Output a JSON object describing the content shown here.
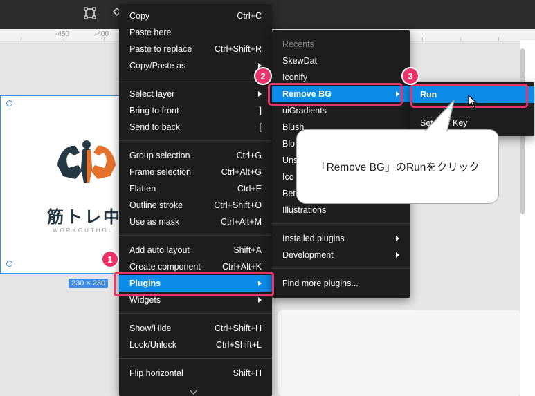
{
  "ruler": {
    "labels": [
      "-450",
      "-400"
    ]
  },
  "canvas": {
    "logo_text": "筋トレ中",
    "logo_sub": "WORKOUTHOL",
    "frame_size": "230 × 230"
  },
  "context_menu": {
    "items": [
      {
        "label": "Copy",
        "shortcut": "Ctrl+C"
      },
      {
        "label": "Paste here",
        "shortcut": ""
      },
      {
        "label": "Paste to replace",
        "shortcut": "Ctrl+Shift+R"
      },
      {
        "label": "Copy/Paste as",
        "shortcut": ""
      },
      {
        "label": "Select layer",
        "shortcut": ""
      },
      {
        "label": "Bring to front",
        "shortcut": "]"
      },
      {
        "label": "Send to back",
        "shortcut": "["
      },
      {
        "label": "Group selection",
        "shortcut": "Ctrl+G"
      },
      {
        "label": "Frame selection",
        "shortcut": "Ctrl+Alt+G"
      },
      {
        "label": "Flatten",
        "shortcut": "Ctrl+E"
      },
      {
        "label": "Outline stroke",
        "shortcut": "Ctrl+Shift+O"
      },
      {
        "label": "Use as mask",
        "shortcut": "Ctrl+Alt+M"
      },
      {
        "label": "Add auto layout",
        "shortcut": "Shift+A"
      },
      {
        "label": "Create component",
        "shortcut": "Ctrl+Alt+K"
      },
      {
        "label": "Plugins",
        "shortcut": ""
      },
      {
        "label": "Widgets",
        "shortcut": ""
      },
      {
        "label": "Show/Hide",
        "shortcut": "Ctrl+Shift+H"
      },
      {
        "label": "Lock/Unlock",
        "shortcut": "Ctrl+Shift+L"
      },
      {
        "label": "Flip horizontal",
        "shortcut": "Shift+H"
      }
    ]
  },
  "plugins_menu": {
    "header": "Recents",
    "items": [
      "SkewDat",
      "Iconify",
      "Remove BG",
      "uiGradients",
      "Blush",
      "Blo",
      "Uns",
      "Ico",
      "Bet",
      "Illustrations"
    ],
    "installed": "Installed plugins",
    "development": "Development",
    "find_more": "Find more plugins..."
  },
  "remove_bg_menu": {
    "run": "Run",
    "set_key": "Set A",
    "set_key_tail": "Key"
  },
  "annotations": {
    "badge1": "1",
    "badge2": "2",
    "badge3": "3",
    "bubble": "「Remove BG」のRunをクリック"
  },
  "colors": {
    "menu_bg": "#1e1e1e",
    "selected": "#0c8ce9",
    "highlight": "#e8336b",
    "selection_blue": "#3d8de8"
  }
}
